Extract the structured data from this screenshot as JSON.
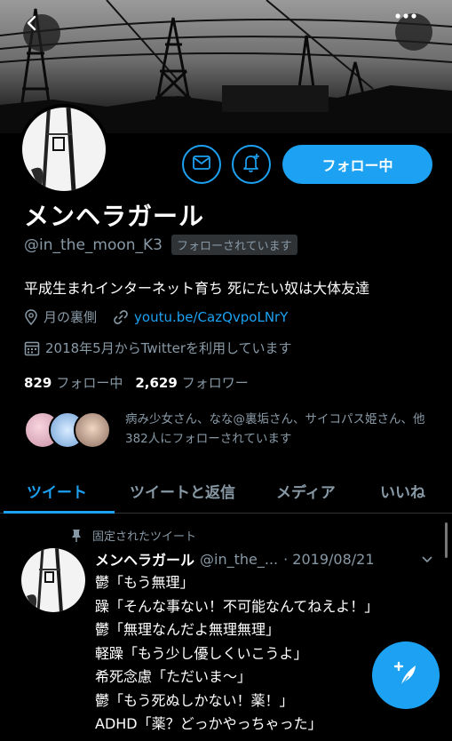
{
  "header": {
    "back_icon": "chevron-left-icon",
    "more_icon": "more-horizontal-icon"
  },
  "profile": {
    "display_name": "メンヘラガール",
    "handle": "@in_the_moon_K3",
    "follows_you_badge": "フォローされています",
    "bio": "平成生まれインターネット育ち 死にたい奴は大体友達",
    "location": "月の裏側",
    "link": "youtu.be/CazQvpoLNrY",
    "joined": "2018年5月からTwitterを利用しています",
    "following_count": "829",
    "following_label": "フォロー中",
    "followers_count": "2,629",
    "followers_label": "フォロワー",
    "followed_by_text": "病み少女さん、なな@裏垢さん、サイコパス姫さん、他382人にフォローされています"
  },
  "actions": {
    "message_icon": "mail-icon",
    "notify_icon": "bell-plus-icon",
    "follow_label": "フォロー中"
  },
  "tabs": [
    {
      "label": "ツイート",
      "active": true
    },
    {
      "label": "ツイートと返信",
      "active": false
    },
    {
      "label": "メディア",
      "active": false
    },
    {
      "label": "いいね",
      "active": false
    }
  ],
  "tweet": {
    "pinned_label": "固定されたツイート",
    "author": "メンヘラガール",
    "handle": "@in_the_...",
    "date": "· 2019/08/21",
    "lines": [
      "鬱「もう無理」",
      "躁「そんな事ない！不可能なんてねえよ！」",
      "鬱「無理なんだよ無理無理」",
      "軽躁「もう少し優しくいこうよ」",
      "希死念慮「ただいま〜」",
      "鬱「もう死ぬしかない！薬！」",
      "ADHD「薬？どっかやっちゃった」"
    ]
  },
  "colors": {
    "accent": "#1da1f2",
    "secondary_text": "#8899a6",
    "background": "#000000"
  }
}
